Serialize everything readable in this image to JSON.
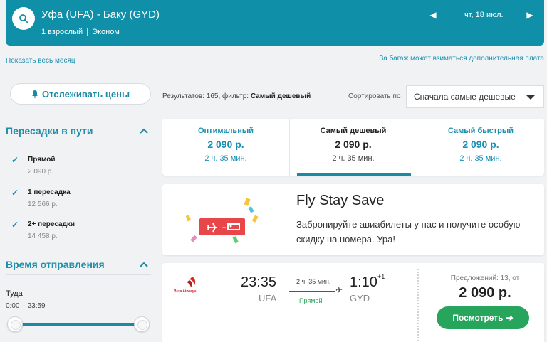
{
  "header": {
    "route": "Уфа (UFA) - Баку (GYD)",
    "passengers": "1 взрослый",
    "cabin": "Эконом",
    "date": "чт, 18 июл.",
    "prev_icon": "triangle-left-icon",
    "next_icon": "triangle-right-icon",
    "bg_color": "#0f8fa8"
  },
  "links": {
    "whole_month": "Показать весь месяц",
    "baggage_note": "За багаж может взиматься дополнительная плата"
  },
  "sidebar": {
    "track_button": "Отслеживать цены",
    "transfers": {
      "title": "Пересадки в пути",
      "items": [
        {
          "label": "Прямой",
          "price": "2 090 р.",
          "checked": true
        },
        {
          "label": "1 пересадка",
          "price": "12 566 р.",
          "checked": true
        },
        {
          "label": "2+ пересадки",
          "price": "14 458 р.",
          "checked": true
        }
      ]
    },
    "departure": {
      "title": "Время отправления",
      "direction": "Туда",
      "range": "0:00 – 23:59"
    }
  },
  "results": {
    "summary_prefix": "Результатов: 165, фильтр:",
    "summary_filter": "Самый дешевый",
    "sort_label": "Сортировать по",
    "sort_value": "Сначала самые дешевые"
  },
  "tabs": [
    {
      "title": "Оптимальный",
      "price": "2 090 р.",
      "time": "2 ч. 35 мин.",
      "active": false
    },
    {
      "title": "Самый дешевый",
      "price": "2 090 р.",
      "time": "2 ч. 35 мин.",
      "active": true
    },
    {
      "title": "Самый быстрый",
      "price": "2 090 р.",
      "time": "2 ч. 35 мин.",
      "active": false
    }
  ],
  "promo": {
    "title": "Fly Stay Save",
    "text": "Забронируйте авиабилеты у нас и получите особую скидку на номера. Ура!",
    "icon": "plane-plus-bed-icon"
  },
  "flight": {
    "airline": "Buta Airways",
    "dep_time": "23:35",
    "dep_code": "UFA",
    "duration": "2 ч. 35 мин.",
    "stop_type": "Прямой",
    "arr_time": "1:10",
    "arr_day_offset": "+1",
    "arr_code": "GYD",
    "offers": "Предложений: 13, от",
    "price": "2 090 р.",
    "button": "Посмотреть",
    "button_color": "#27a55c"
  },
  "colors": {
    "accent": "#1a8aa4",
    "link": "#1b8fb1",
    "green": "#26a35a"
  }
}
